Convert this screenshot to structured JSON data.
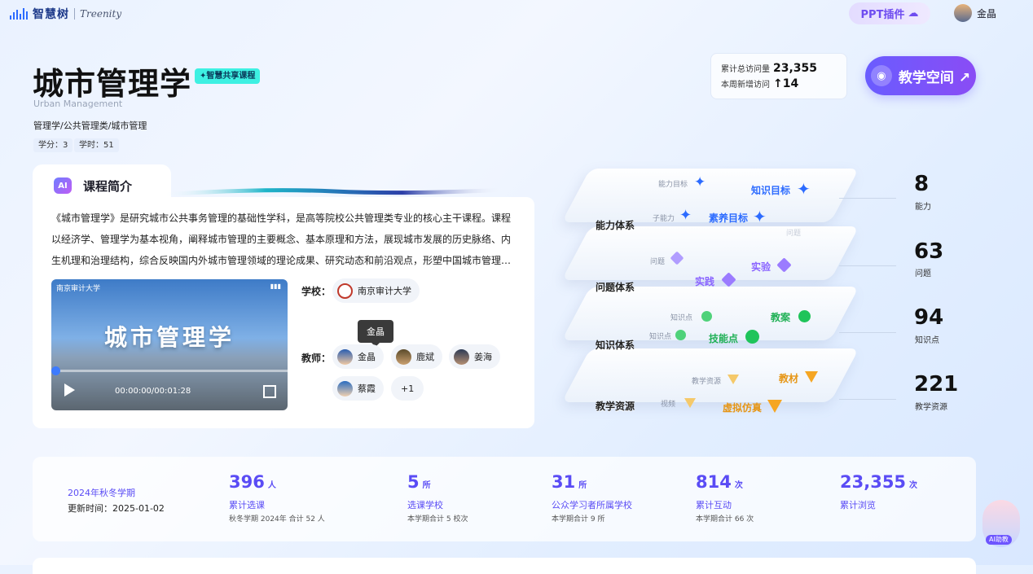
{
  "header": {
    "logo_text": "智慧树",
    "logo_sub": "Treenity",
    "ppt_label": "PPT插件",
    "user_name": "金晶"
  },
  "course": {
    "title": "城市管理学",
    "share_badge": "✦智慧共享课程",
    "english": "Urban Management",
    "category": "管理学/公共管理类/城市管理",
    "credit": "学分：3",
    "hours": "学时：51"
  },
  "visits": {
    "total_label": "累计总访问量",
    "total_value": "23,355",
    "week_label": "本周新增访问",
    "week_value": "↑14"
  },
  "space_button": "教学空间 ↗",
  "intro": {
    "title": "课程简介",
    "ai": "AI",
    "text": "《城市管理学》是研究城市公共事务管理的基础性学科，是高等院校公共管理类专业的核心主干课程。课程以经济学、管理学为基本视角，阐释城市管理的主要概念、基本原理和方法，展现城市发展的历史脉络、内生机理和治理结构，综合反映国内外城市管理领域的理论成果、研究动态和前沿观点，形塑中国城市管理的理论体系。",
    "video_title": "城市管理学",
    "video_logo": "南京审计大学",
    "video_time": "00:00:00/00:01:28",
    "school_label": "学校：",
    "school_name": "南京审计大学",
    "teacher_label": "教师：",
    "teachers": [
      "金晶",
      "鹿斌",
      "姜海",
      "蔡霞"
    ],
    "teacher_more": "+1",
    "tooltip": "金晶"
  },
  "layers": {
    "ability": {
      "label": "能力体系",
      "small1": "能力目标",
      "big1": "知识目标",
      "small2": "子能力",
      "big2": "素养目标",
      "faint": "问题"
    },
    "problem": {
      "label": "问题体系",
      "small1": "问题",
      "big1": "实验",
      "big2": "实践"
    },
    "knowledge": {
      "label": "知识体系",
      "small1": "知识点",
      "small2": "知识点",
      "big1": "教案",
      "big2": "技能点"
    },
    "resource": {
      "label": "教学资源",
      "small1": "教学资源",
      "small2": "视频",
      "big1": "教材",
      "big2": "虚拟仿真"
    }
  },
  "side_stats": [
    {
      "value": "8",
      "label": "能力"
    },
    {
      "value": "63",
      "label": "问题"
    },
    {
      "value": "94",
      "label": "知识点"
    },
    {
      "value": "221",
      "label": "教学资源"
    }
  ],
  "bottom": {
    "term": "2024年秋冬学期",
    "updated": "更新时间：2025-01-02",
    "stats": [
      {
        "value": "396",
        "unit": "人",
        "label": "累计选课",
        "sub": "秋冬学期 2024年 合计 52 人"
      },
      {
        "value": "5",
        "unit": "所",
        "label": "选课学校",
        "sub": "本学期合计 5 校次"
      },
      {
        "value": "31",
        "unit": "所",
        "label": "公众学习者所属学校",
        "sub": "本学期合计 9 所"
      },
      {
        "value": "814",
        "unit": "次",
        "label": "累计互动",
        "sub": "本学期合计 66 次"
      },
      {
        "value": "23,355",
        "unit": "次",
        "label": "累计浏览",
        "sub": ""
      }
    ],
    "ai_badge": "AI助教"
  },
  "colors": {
    "accent": "#5a4cf5",
    "blue_star": "#2c6bff",
    "purple": "#9b7bff",
    "green": "#1fc45a",
    "orange": "#f5a623"
  }
}
